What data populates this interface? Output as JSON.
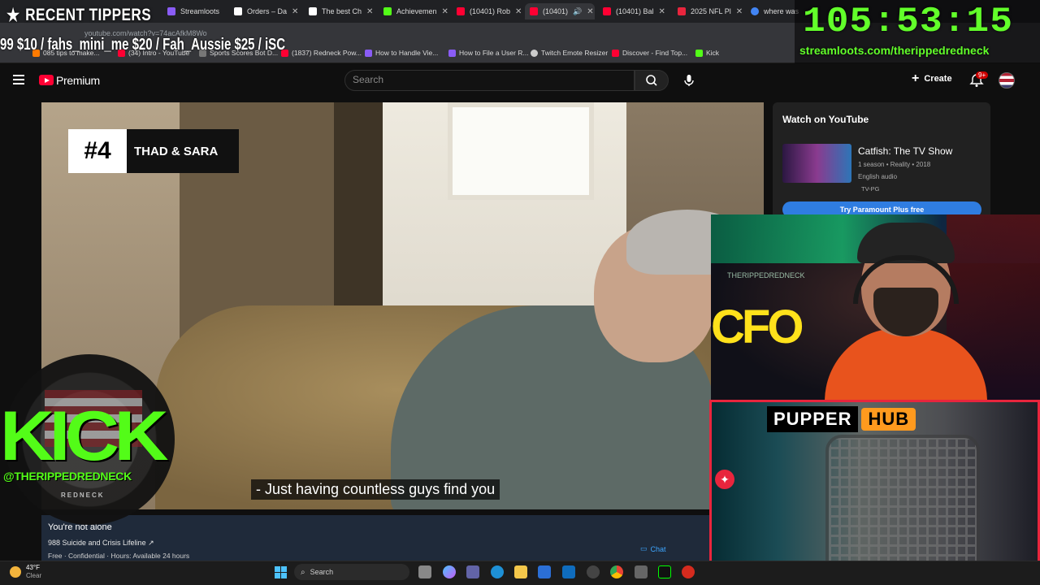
{
  "browser": {
    "tabs": [
      {
        "label": "Streamloots",
        "color": "#8a5cf6"
      },
      {
        "label": "Orders – Da",
        "color": "#ffffff"
      },
      {
        "label": "The best Ch",
        "color": "#ffffff"
      },
      {
        "label": "Achievemen",
        "color": "#53fc18"
      },
      {
        "label": "(10401) Rob",
        "color": "#ff0033"
      },
      {
        "label": "(10401)",
        "color": "#ff0033"
      },
      {
        "label": "(10401) Bal",
        "color": "#ff0033"
      },
      {
        "label": "2025 NFL Pl",
        "color": "#e8253d"
      },
      {
        "label": "where was",
        "color": "#4285f4"
      }
    ],
    "url": "youtube.com/watch?v=74acAfkM8Wo",
    "bookmarks": [
      {
        "label": "085 tips to make...",
        "color": "#ff7b00"
      },
      {
        "label": "(34) Intro - YouTube",
        "color": "#ff0033"
      },
      {
        "label": "Sports Scores Bot D...",
        "color": "#777777"
      },
      {
        "label": "(1837) Redneck Pow...",
        "color": "#ff0033"
      },
      {
        "label": "How to Handle Vie...",
        "color": "#8a5cf6"
      },
      {
        "label": "How to File a User R...",
        "color": "#8a5cf6"
      },
      {
        "label": "Twitch Emote Resizer",
        "color": "#cccccc"
      },
      {
        "label": "Discover - Find Top...",
        "color": "#ff0033"
      },
      {
        "label": "Kick",
        "color": "#53fc18"
      }
    ]
  },
  "overlay": {
    "tippers_title": "RECENT TIPPERS",
    "tippers_ticker": "99 $10 / fahs_mini_me $20 / Fah_Aussie $25 / iSC",
    "timer": "105:53:15",
    "timer_site": "streamloots.com/therippedredneck",
    "kick_text": "KICK",
    "kick_handle": "@THERIPPEDREDNECK",
    "kick_sub": "REDNECK",
    "pupper_a": "PUPPER",
    "pupper_b": "HUB",
    "webcam_sign": "THERIPPEDREDNECK"
  },
  "youtube": {
    "brand": "Premium",
    "search_placeholder": "Search",
    "create_label": "Create",
    "notif_badge": "9+",
    "video": {
      "card_number": "#4",
      "card_names": "THAD & SARA",
      "caption": "- Just having countless guys find you"
    },
    "crisis": {
      "title": "You're not alone",
      "line": "988 Suicide and Crisis Lifeline ↗",
      "info": "Free · Confidential · Hours: Available 24 hours",
      "chat": "Chat"
    },
    "watch_panel": {
      "title": "Watch on YouTube",
      "show_title": "Catfish: The TV Show",
      "show_meta": "1 season • Reality • 2018",
      "show_audio": "English audio",
      "show_rating": "TV-PG",
      "cta": "Try Paramount Plus free"
    }
  },
  "taskbar": {
    "temp": "43°F",
    "condition": "Clear",
    "search_placeholder": "Search"
  }
}
